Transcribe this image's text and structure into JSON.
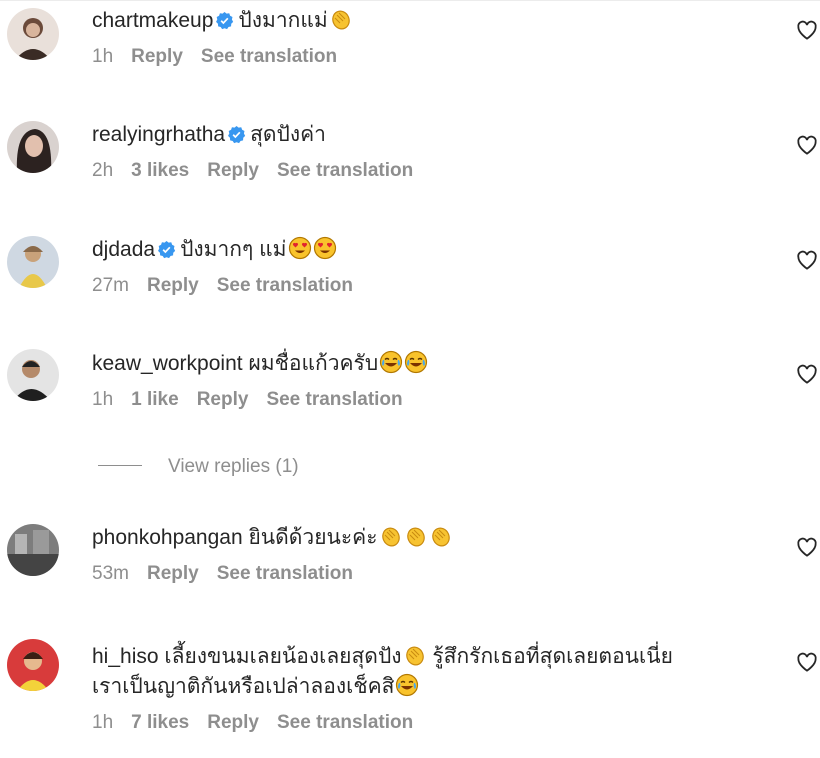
{
  "comments": [
    {
      "username": "chartmakeup",
      "verified": true,
      "text": "ปังมากแม่",
      "emojis": [
        "clap"
      ],
      "time": "1h",
      "likes": "",
      "reply": "Reply",
      "see_translation": "See translation"
    },
    {
      "username": "realyingrhatha",
      "verified": true,
      "text": "สุดปังค่า",
      "emojis": [],
      "time": "2h",
      "likes": "3 likes",
      "reply": "Reply",
      "see_translation": "See translation"
    },
    {
      "username": "djdada",
      "verified": true,
      "text": "ปังมากๆ แม่",
      "emojis": [
        "heart-eyes",
        "heart-eyes"
      ],
      "time": "27m",
      "likes": "",
      "reply": "Reply",
      "see_translation": "See translation"
    },
    {
      "username": "keaw_workpoint",
      "verified": false,
      "text": "ผมชื่อแก้วครับ",
      "emojis": [
        "laugh-cry",
        "laugh-cry"
      ],
      "time": "1h",
      "likes": "1 like",
      "reply": "Reply",
      "see_translation": "See translation"
    },
    {
      "username": "phonkohpangan",
      "verified": false,
      "text": "ยินดีด้วยนะค่ะ",
      "emojis": [
        "clap",
        "clap",
        "clap"
      ],
      "time": "53m",
      "likes": "",
      "reply": "Reply",
      "see_translation": "See translation"
    },
    {
      "username": "hi_hiso",
      "verified": false,
      "text": "เลี้ยงขนมเลยน้องเลยสุดปัง",
      "text2": "รู้สึกรักเธอที่สุดเลยตอนเนี่ย",
      "text3": "เราเป็นญาติกันหรือเปล่าลองเช็คสิ",
      "emojis": [
        "clap"
      ],
      "time": "1h",
      "likes": "7 likes",
      "reply": "Reply",
      "see_translation": "See translation"
    }
  ],
  "view_replies": "View replies (1)",
  "icons": {
    "heart": "heart-outline-icon",
    "verified": "verified-badge-icon",
    "verified_color": "#3897f0"
  }
}
